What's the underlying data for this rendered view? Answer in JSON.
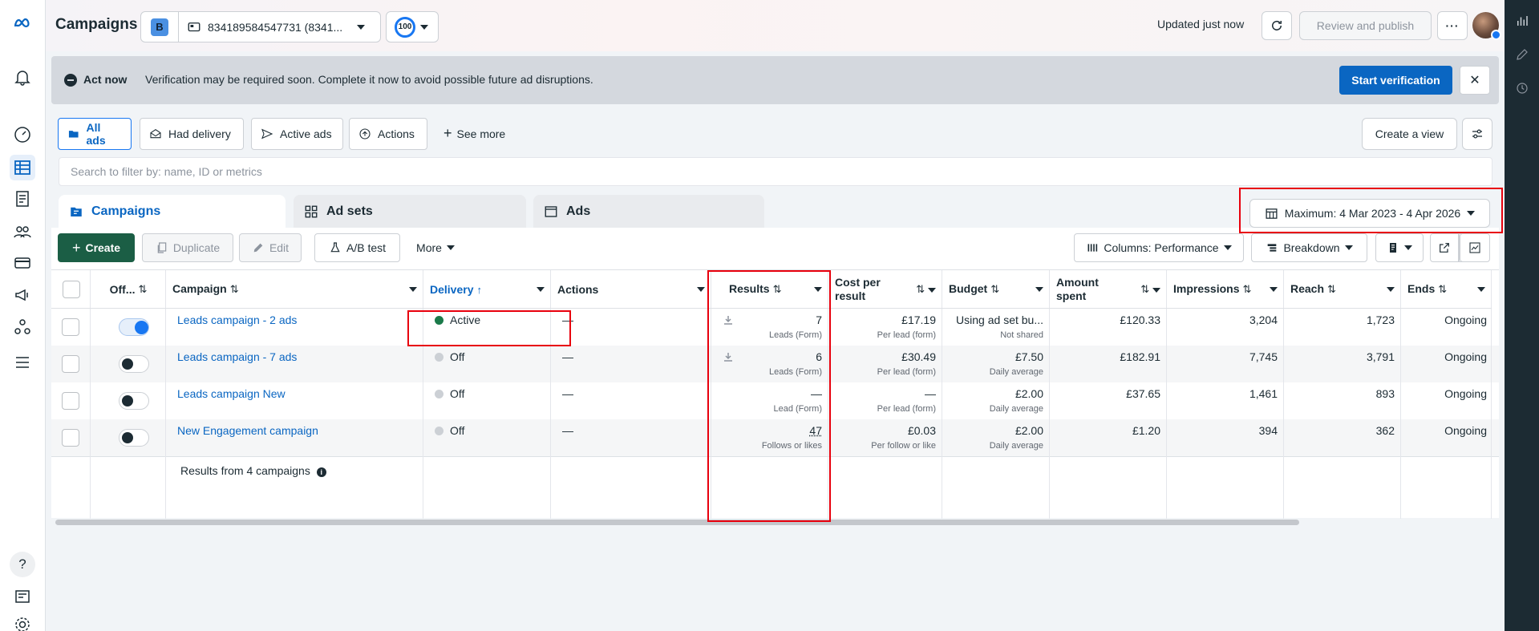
{
  "header": {
    "title": "Campaigns",
    "account_badge": "B",
    "account_name": "834189584547731 (8341...",
    "score": "100",
    "updated": "Updated just now",
    "review_label": "Review and publish",
    "more_label": "···"
  },
  "banner": {
    "act_label": "Act now",
    "message": "Verification may be required soon. Complete it now to avoid possible future ad disruptions.",
    "verify_label": "Start verification",
    "close_label": "✕"
  },
  "filters": {
    "items": [
      "All ads",
      "Had delivery",
      "Active ads",
      "Actions"
    ],
    "see_more": "See more",
    "create_view": "Create a view"
  },
  "search": {
    "placeholder": "Search to filter by: name, ID or metrics"
  },
  "levels": [
    "Campaigns",
    "Ad sets",
    "Ads"
  ],
  "date_range": "Maximum: 4 Mar 2023 - 4 Apr 2026",
  "toolbar": {
    "create": "Create",
    "duplicate": "Duplicate",
    "edit": "Edit",
    "ab_test": "A/B test",
    "more": "More",
    "columns": "Columns: Performance",
    "breakdown": "Breakdown"
  },
  "table": {
    "headers": {
      "off": "Off...",
      "campaign": "Campaign",
      "delivery": "Delivery",
      "actions": "Actions",
      "results": "Results",
      "cost": "Cost per result",
      "budget": "Budget",
      "spent": "Amount spent",
      "impressions": "Impressions",
      "reach": "Reach",
      "ends": "Ends"
    },
    "rows": [
      {
        "on": true,
        "name": "Leads campaign - 2 ads",
        "delivery": "Active",
        "actions": "—",
        "results": "7",
        "results_sub": "Leads (Form)",
        "cost": "£17.19",
        "cost_sub": "Per lead (form)",
        "budget": "Using ad set bu...",
        "budget_sub": "Not shared",
        "spent": "£120.33",
        "impressions": "3,204",
        "reach": "1,723",
        "ends": "Ongoing"
      },
      {
        "on": false,
        "name": "Leads campaign - 7 ads",
        "delivery": "Off",
        "actions": "—",
        "results": "6",
        "results_sub": "Leads (Form)",
        "cost": "£30.49",
        "cost_sub": "Per lead (form)",
        "budget": "£7.50",
        "budget_sub": "Daily average",
        "spent": "£182.91",
        "impressions": "7,745",
        "reach": "3,791",
        "ends": "Ongoing"
      },
      {
        "on": false,
        "name": "Leads campaign New",
        "delivery": "Off",
        "actions": "—",
        "results": "—",
        "results_sub": "Lead (Form)",
        "cost": "—",
        "cost_sub": "Per lead (form)",
        "budget": "£2.00",
        "budget_sub": "Daily average",
        "spent": "£37.65",
        "impressions": "1,461",
        "reach": "893",
        "ends": "Ongoing"
      },
      {
        "on": false,
        "name": "New Engagement campaign",
        "delivery": "Off",
        "actions": "—",
        "results": "47",
        "results_sub": "Follows or likes",
        "cost": "£0.03",
        "cost_sub": "Per follow or like",
        "budget": "£2.00",
        "budget_sub": "Daily average",
        "spent": "£1.20",
        "impressions": "394",
        "reach": "362",
        "ends": "Ongoing"
      }
    ],
    "summary": "Results from 4 campaigns"
  },
  "colors": {
    "accent": "#0a66c2",
    "create": "#1b5e45",
    "active_dot": "#1b7a4a",
    "highlight": "#e8000d"
  }
}
